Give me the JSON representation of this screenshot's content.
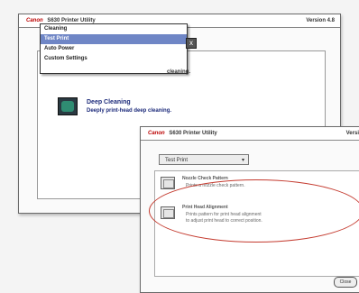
{
  "window1": {
    "brand": "Canon",
    "title": "S630 Printer Utility",
    "version": "Version 4.8",
    "menu_items": [
      "Cleaning",
      "Test Print",
      "Auto Power",
      "Custom Settings"
    ],
    "selected_index": 1,
    "close_glyph": "x",
    "cleaning_text": "cleaning.",
    "deep_title": "Deep Cleaning",
    "deep_desc": "Deeply print-head deep cleaning."
  },
  "window2": {
    "brand": "Canon",
    "title": "S630 Printer Utility",
    "version": "Versi",
    "select_value": "Test Print",
    "select_arrow": "▾",
    "option1_title": "Nozzle Check Pattern",
    "option1_desc": "Prints a nozzle check pattern.",
    "option2_title": "Print Head Alignment",
    "option2_desc_line1": "Prints pattern for print head alignment",
    "option2_desc_line2": "to adjust print head to correct position.",
    "ok_label": "Close"
  },
  "accent": {
    "selection": "#6f86c6",
    "highlight_oval": "#c43a2e",
    "deep_text": "#1c2a7a"
  }
}
